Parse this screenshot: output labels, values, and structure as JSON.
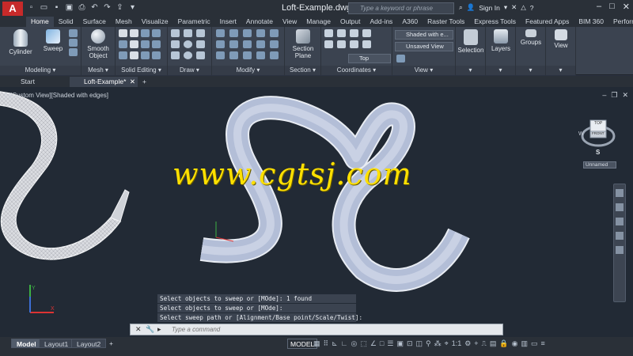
{
  "app": {
    "logo": "A",
    "doc_title": "Loft-Example.dwg",
    "search_placeholder": "Type a keyword or phrase",
    "sign_in": "Sign In"
  },
  "ribbon_tabs": [
    "Home",
    "Solid",
    "Surface",
    "Mesh",
    "Visualize",
    "Parametric",
    "Insert",
    "Annotate",
    "View",
    "Manage",
    "Output",
    "Add-ins",
    "A360",
    "Raster Tools",
    "Express Tools",
    "Featured Apps",
    "BIM 360",
    "Performance"
  ],
  "active_ribbon_tab": "Home",
  "ribbon": {
    "cylinder": "Cylinder",
    "sweep": "Sweep",
    "smooth_object_1": "Smooth",
    "smooth_object_2": "Object",
    "section_plane_1": "Section",
    "section_plane_2": "Plane",
    "visual_style": "Shaded with e...",
    "saved_view": "Unsaved View",
    "view_dir": "Top",
    "selection": "Selection",
    "layers": "Layers",
    "groups": "Groups",
    "view": "View",
    "panels": {
      "modeling": "Modeling",
      "mesh": "Mesh",
      "solid_editing": "Solid Editing",
      "draw": "Draw",
      "modify": "Modify",
      "section": "Section",
      "coordinates": "Coordinates",
      "view": "View"
    }
  },
  "file_tabs": {
    "start": "Start",
    "active": "Loft-Example*",
    "add": "+"
  },
  "viewport": {
    "label": "[-][Custom View][Shaded with edges]",
    "viewcube_top": "TOP",
    "viewcube_front": "FRONT",
    "compass_w": "W",
    "compass_s": "S",
    "ucs_name": "Unnamed"
  },
  "command_history": [
    "Select objects to sweep or [MOde]: 1 found",
    "Select objects to sweep or [MOde]:",
    "Select sweep path or [Alignment/Base point/Scale/Twist]:"
  ],
  "command_placeholder": "Type a command",
  "layout_tabs": [
    "Model",
    "Layout1",
    "Layout2"
  ],
  "add_layout": "+",
  "status": {
    "model": "MODEL",
    "scale": "1:1"
  },
  "watermark": "www.cgtsj.com",
  "colors": {
    "ribbon_bg": "#3b4350",
    "title_bg": "#2a3038",
    "viewport_bg": "#222a35",
    "sweep_fill": "#b9c3da",
    "watermark": "#ffe000"
  }
}
